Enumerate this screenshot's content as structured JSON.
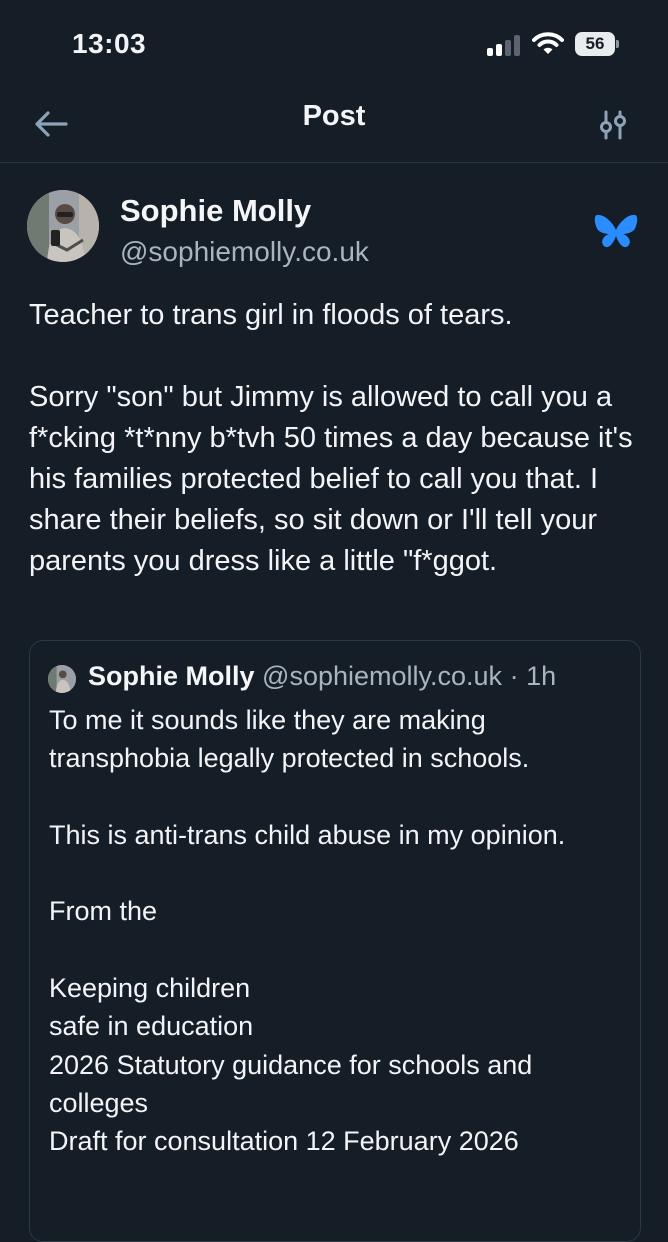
{
  "status": {
    "time": "13:03",
    "battery": "56"
  },
  "header": {
    "title": "Post",
    "back_icon": "arrow-left-icon",
    "settings_icon": "sliders-icon"
  },
  "post": {
    "author_name": "Sophie Molly",
    "author_handle": "@sophiemolly.co.uk",
    "platform_icon": "butterfly-icon",
    "accent_color": "#2a8cff",
    "text_line_1": "Teacher to trans girl in floods of tears.",
    "text_line_2": "Sorry \"son\" but Jimmy is allowed to call you a f*cking *t*nny b*tvh 50 times a day because it's his families protected belief to call you that. I share their beliefs, so sit down or I'll tell your parents you dress like a little \"f*ggot."
  },
  "quote": {
    "author_name": "Sophie Molly",
    "author_handle": "@sophiemolly.co.uk",
    "separator": "·",
    "time": "1h",
    "p1": "To me it sounds like they are making transphobia legally protected in schools.",
    "p2": "This is anti-trans child abuse in my opinion.",
    "p3": "From the",
    "l1": "Keeping children",
    "l2": "safe in education",
    "l3": "2026 Statutory guidance for schools and colleges",
    "l4": "Draft for consultation 12 February 2026"
  }
}
